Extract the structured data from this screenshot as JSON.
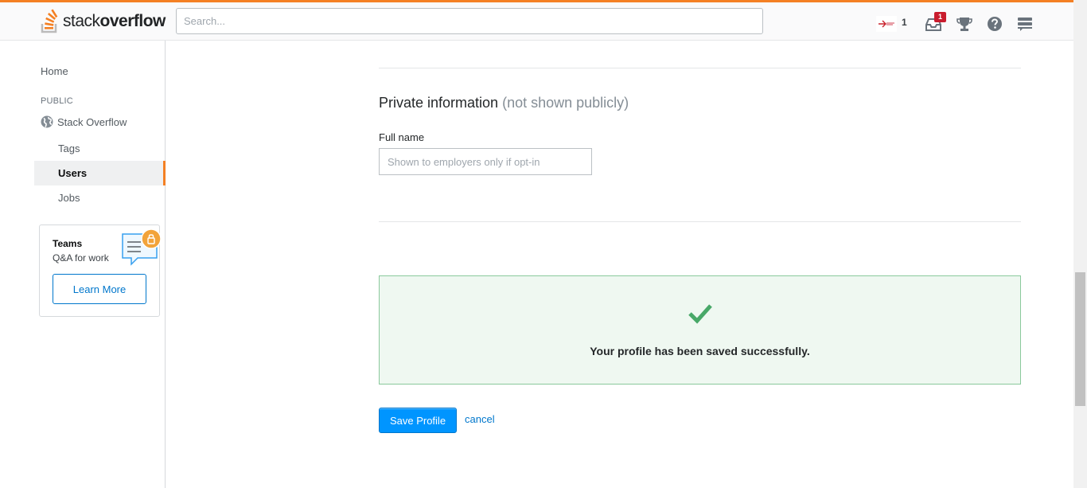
{
  "header": {
    "logo_light": "stack",
    "logo_bold": "overflow",
    "search_placeholder": "Search...",
    "reputation": "1",
    "inbox_count": "1",
    "icons": [
      "avatar-icon",
      "inbox-icon",
      "achievements-icon",
      "help-icon",
      "site-switcher-icon"
    ]
  },
  "sidebar": {
    "home": "Home",
    "public_heading": "PUBLIC",
    "stack_overflow": "Stack Overflow",
    "items": [
      {
        "label": "Tags",
        "active": false
      },
      {
        "label": "Users",
        "active": true
      },
      {
        "label": "Jobs",
        "active": false
      }
    ],
    "teams": {
      "title": "Teams",
      "subtitle": "Q&A for work",
      "button": "Learn More"
    }
  },
  "main": {
    "section_title": "Private information",
    "section_title_note": "(not shown publicly)",
    "full_name_label": "Full name",
    "full_name_placeholder": "Shown to employers only if opt-in",
    "full_name_value": "",
    "success_message": "Your profile has been saved successfully.",
    "save_button": "Save Profile",
    "cancel_link": "cancel"
  },
  "colors": {
    "accent": "#f48024",
    "primary_button": "#0095ff",
    "link": "#0077cc",
    "success_bg": "#eff8f1",
    "success_border": "#8ac99c",
    "check": "#48a868"
  }
}
